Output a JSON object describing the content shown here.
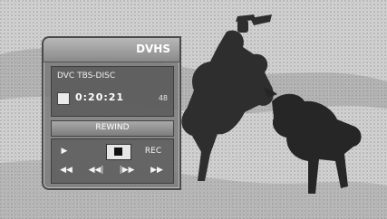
{
  "osd": {
    "title": "DVHS",
    "disc_type": "DVC TBS-DISC",
    "counter": "0:20:21",
    "counter_mode": "48",
    "rewind_label": "REWIND",
    "controls": {
      "play": "▶",
      "stop_icon": "stop-icon",
      "rec": "REC",
      "rew": "◀◀",
      "skip_back": "◀◀|",
      "skip_fwd": "|▶▶",
      "ffwd": "▶▶"
    }
  },
  "colors": {
    "panel": "#787878",
    "header": "#a0a0a0",
    "text": "#ffffff"
  }
}
